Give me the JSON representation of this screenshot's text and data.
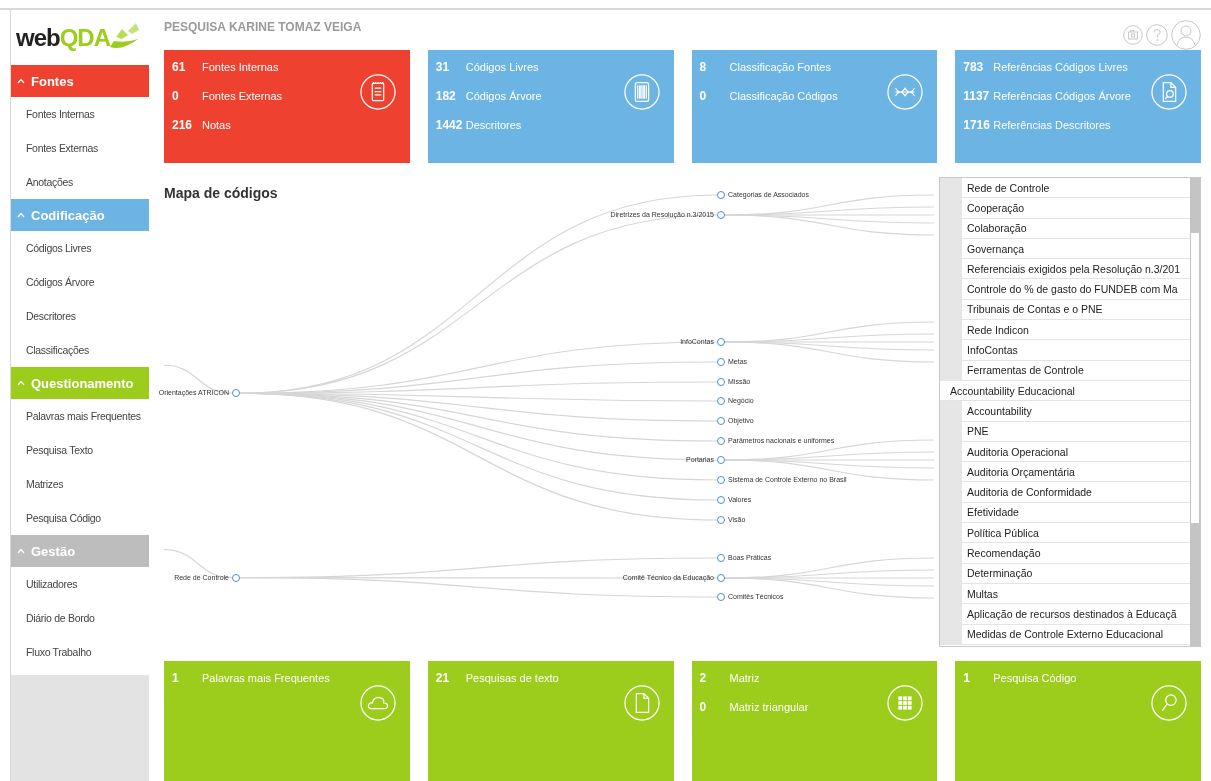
{
  "logo": [
    "web",
    "QDA"
  ],
  "header": {
    "title": "PESQUISA KARINE TOMAZ VEIGA"
  },
  "sidebar": {
    "sections": [
      {
        "label": "Fontes",
        "color": "#ef4130",
        "expanded": true,
        "items": [
          "Fontes Internas",
          "Fontes Externas",
          "Anotações"
        ]
      },
      {
        "label": "Codificação",
        "color": "#6cb4e4",
        "expanded": true,
        "items": [
          "Códigos Livres",
          "Códigos Árvore",
          "Descritores",
          "Classificações"
        ]
      },
      {
        "label": "Questionamento",
        "color": "#9ccc1c",
        "expanded": true,
        "items": [
          "Palavras mais Frequentes",
          "Pesquisa Texto",
          "Matrizes",
          "Pesquisa Código"
        ]
      },
      {
        "label": "Gestão",
        "color": "#bdbdbd",
        "expanded": true,
        "items": [
          "Utilizadores",
          "Diário de Bordo",
          "Fluxo Trabalho"
        ]
      }
    ]
  },
  "summary_cards": [
    {
      "color": "#ef4130",
      "rows": [
        {
          "count": "61",
          "label": "Fontes Internas"
        },
        {
          "count": "0",
          "label": "Fontes Externas"
        },
        {
          "count": "216",
          "label": "Notas"
        }
      ]
    },
    {
      "color": "#6cb4e4",
      "rows": [
        {
          "count": "31",
          "label": "Códigos Livres"
        },
        {
          "count": "182",
          "label": "Códigos Árvore"
        },
        {
          "count": "1442",
          "label": "Descritores"
        }
      ]
    },
    {
      "color": "#6cb4e4",
      "rows": [
        {
          "count": "8",
          "label": "Classificação Fontes"
        },
        {
          "count": "0",
          "label": "Classificação Códigos"
        }
      ]
    },
    {
      "color": "#6cb4e4",
      "rows": [
        {
          "count": "783",
          "label": "Referências Códigos Livres"
        },
        {
          "count": "1137",
          "label": "Referências Códigos Árvore"
        },
        {
          "count": "1716",
          "label": "Referências Descritores"
        }
      ]
    }
  ],
  "code_map": {
    "title": "Mapa de códigos",
    "nodes": [
      {
        "label": "Orientações ATRICON",
        "children": [
          {
            "label": "Categorias de Associados",
            "kind": "leaf"
          },
          {
            "label": "Diretrizes da Resolução n.3/2015",
            "kind": "branch"
          },
          {
            "label": "InfoContas",
            "kind": "branch"
          },
          {
            "label": "Metas",
            "kind": "leaf"
          },
          {
            "label": "Missão",
            "kind": "leaf"
          },
          {
            "label": "Negócio",
            "kind": "leaf"
          },
          {
            "label": "Objetivo",
            "kind": "leaf"
          },
          {
            "label": "Parâmetros nacionais e uniformes",
            "kind": "leaf"
          },
          {
            "label": "Portarias",
            "kind": "branch"
          },
          {
            "label": "Sistema de Controle Externo no Brasil",
            "kind": "leaf"
          },
          {
            "label": "Valores",
            "kind": "leaf"
          },
          {
            "label": "Visão",
            "kind": "leaf"
          }
        ]
      },
      {
        "label": "Rede de Controle",
        "children": [
          {
            "label": "Boas Práticas",
            "kind": "leaf"
          },
          {
            "label": "Comitê Técnico da Educação",
            "kind": "branch"
          },
          {
            "label": "Comitês Técnicos",
            "kind": "leaf"
          }
        ]
      }
    ]
  },
  "code_list": {
    "groups": [
      {
        "children": [
          "Rede de Controle",
          "Cooperação",
          "Colaboração",
          "Governança",
          "Referenciais exigidos pela Resolução n.3/201",
          "Controle do % de gasto do FUNDEB com Ma",
          "Tribunais de Contas e o PNE",
          "Rede Indicon",
          "InfoContas",
          "Ferramentas de Controle"
        ]
      },
      {
        "label": "Accountability Educacional",
        "children": [
          "Accountability",
          "PNE",
          "Auditoria Operacional",
          "Auditoria Orçamentária",
          "Auditoria de Conformidade",
          "Efetividade",
          "Política Pública",
          "Recomendação",
          "Determinação",
          "Multas",
          "Aplicação de recursos destinados à Educaçã",
          "Medidas de Controle Externo Educacional"
        ]
      }
    ]
  },
  "search_cards": [
    {
      "color": "#9ccc1c",
      "rows": [
        {
          "count": "1",
          "label": "Palavras mais Frequentes"
        }
      ]
    },
    {
      "color": "#9ccc1c",
      "rows": [
        {
          "count": "21",
          "label": "Pesquisas de texto"
        }
      ]
    },
    {
      "color": "#9ccc1c",
      "rows": [
        {
          "count": "2",
          "label": "Matriz"
        },
        {
          "count": "0",
          "label": "Matriz triangular"
        }
      ]
    },
    {
      "color": "#9ccc1c",
      "rows": [
        {
          "count": "1",
          "label": "Pesquisa Código"
        }
      ]
    }
  ]
}
